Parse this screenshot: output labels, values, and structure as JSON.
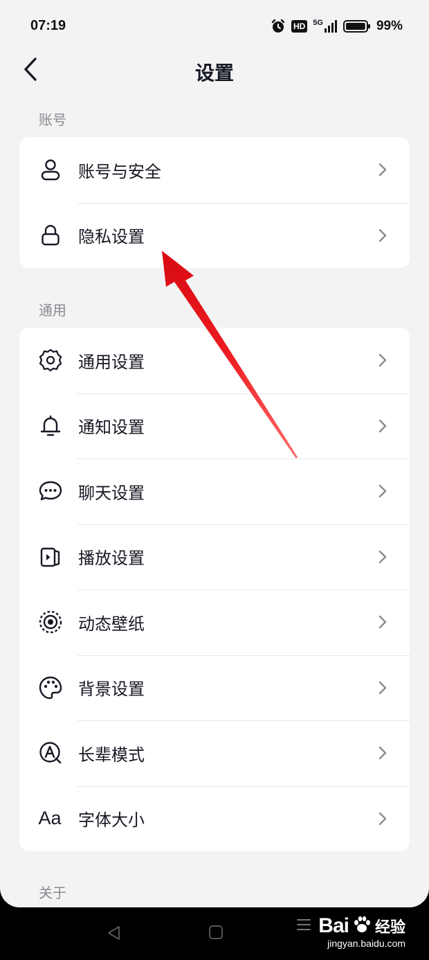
{
  "status_bar": {
    "time": "07:19",
    "hd_badge": "HD",
    "network": "5G",
    "battery_percent": "99%",
    "battery_level": 0.99
  },
  "header": {
    "title": "设置"
  },
  "sections": [
    {
      "label": "账号",
      "items": [
        {
          "label": "账号与安全",
          "icon": "user-icon"
        },
        {
          "label": "隐私设置",
          "icon": "lock-icon"
        }
      ]
    },
    {
      "label": "通用",
      "items": [
        {
          "label": "通用设置",
          "icon": "gear-icon"
        },
        {
          "label": "通知设置",
          "icon": "bell-icon"
        },
        {
          "label": "聊天设置",
          "icon": "chat-bubble-icon"
        },
        {
          "label": "播放设置",
          "icon": "play-icon"
        },
        {
          "label": "动态壁纸",
          "icon": "wallpaper-icon"
        },
        {
          "label": "背景设置",
          "icon": "palette-icon"
        },
        {
          "label": "长辈模式",
          "icon": "elder-mode-icon"
        },
        {
          "label": "字体大小",
          "icon": "font-size-icon",
          "icon_text": "Aa"
        }
      ]
    },
    {
      "label": "关于",
      "items": []
    }
  ],
  "watermark": {
    "brand": "Bai",
    "brand_cn": "经验",
    "url": "jingyan.baidu.com"
  },
  "colors": {
    "background": "#f3f3f4",
    "card": "#ffffff",
    "text_primary": "#161823",
    "text_secondary": "#8a8b91",
    "annotation_arrow": "#e8141b"
  }
}
